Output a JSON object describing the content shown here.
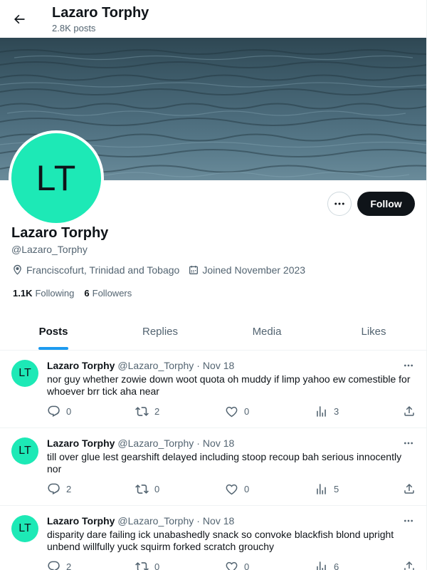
{
  "header": {
    "title": "Lazaro Torphy",
    "post_count": "2.8K posts"
  },
  "profile": {
    "avatar_initials": "LT",
    "name": "Lazaro Torphy",
    "handle": "@Lazaro_Torphy",
    "location": "Franciscofurt, Trinidad and Tobago",
    "joined": "Joined November 2023",
    "following_count": "1.1K",
    "following_label": "Following",
    "followers_count": "6",
    "followers_label": "Followers",
    "follow_label": "Follow",
    "avatar_color": "#1de9b6"
  },
  "tabs": [
    {
      "label": "Posts"
    },
    {
      "label": "Replies"
    },
    {
      "label": "Media"
    },
    {
      "label": "Likes"
    }
  ],
  "posts": [
    {
      "avatar": "LT",
      "name": "Lazaro Torphy",
      "handle": "@Lazaro_Torphy",
      "date": "Nov 18",
      "text": "nor guy whether zowie down woot quota oh muddy if limp yahoo ew comestible for whoever brr tick aha near",
      "replies": "0",
      "reposts": "2",
      "likes": "0",
      "views": "3"
    },
    {
      "avatar": "LT",
      "name": "Lazaro Torphy",
      "handle": "@Lazaro_Torphy",
      "date": "Nov 18",
      "text": "till over glue lest gearshift delayed including stoop recoup bah serious innocently nor",
      "replies": "2",
      "reposts": "0",
      "likes": "0",
      "views": "5"
    },
    {
      "avatar": "LT",
      "name": "Lazaro Torphy",
      "handle": "@Lazaro_Torphy",
      "date": "Nov 18",
      "text": "disparity dare failing ick unabashedly snack so convoke blackfish blond upright unbend willfully yuck squirm forked scratch grouchy",
      "replies": "2",
      "reposts": "0",
      "likes": "0",
      "views": "6"
    }
  ],
  "colors": {
    "accent": "#1d9bf0",
    "text": "#0f1419",
    "secondary": "#536471"
  }
}
